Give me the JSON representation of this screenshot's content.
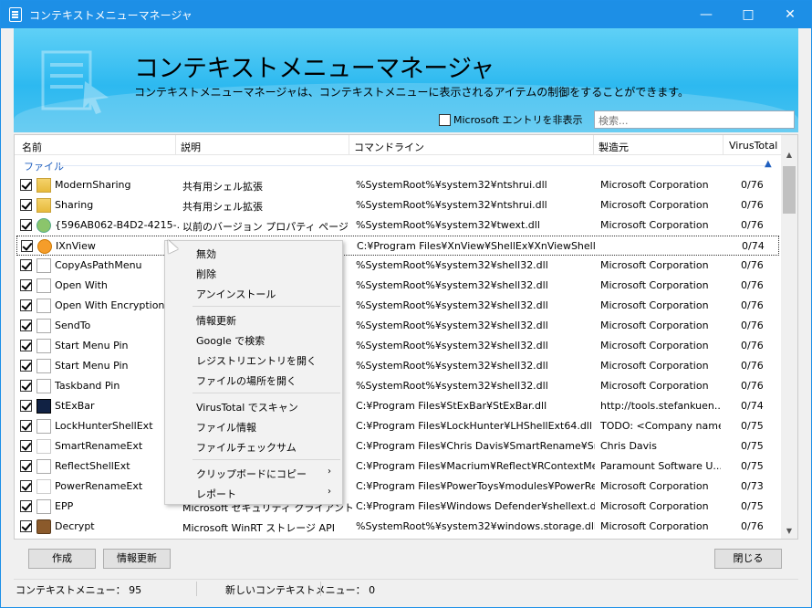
{
  "window": {
    "title": "コンテキストメニューマネージャ",
    "minimize": "—",
    "maximize": "□",
    "close": "✕"
  },
  "header": {
    "title": "コンテキストメニューマネージャ",
    "subtitle": "コンテキストメニューマネージャは、コンテキストメニューに表示されるアイテムの制御をすることができます。",
    "hide_ms_label": "Microsoft エントリを非表示",
    "search_placeholder": "検索..."
  },
  "columns": [
    "名前",
    "説明",
    "コマンドライン",
    "製造元",
    "VirusTotal"
  ],
  "group": {
    "label": "ファイル",
    "arrow": "▲"
  },
  "rows": [
    {
      "name": "ModernSharing",
      "desc": "共有用シェル拡張",
      "cmd": "%SystemRoot%¥system32¥ntshrui.dll",
      "maker": "Microsoft Corporation",
      "vt": "0/76",
      "icon": "folder-share-icon",
      "checked": true
    },
    {
      "name": "Sharing",
      "desc": "共有用シェル拡張",
      "cmd": "%SystemRoot%¥system32¥ntshrui.dll",
      "maker": "Microsoft Corporation",
      "vt": "0/76",
      "icon": "folder-share-icon",
      "checked": true
    },
    {
      "name": "{596AB062-B4D2-4215-...",
      "desc": "以前のバージョン プロパティ ページ",
      "cmd": "%SystemRoot%¥system32¥twext.dll",
      "maker": "Microsoft Corporation",
      "vt": "0/76",
      "icon": "clock-icon",
      "checked": true
    },
    {
      "name": "IXnView",
      "desc": "",
      "cmd": "C:¥Program Files¥XnView¥ShellEx¥XnViewShellExt...",
      "maker": "",
      "vt": "0/74",
      "icon": "xnview-icon",
      "checked": true
    },
    {
      "name": "CopyAsPathMenu",
      "desc": "",
      "cmd": "%SystemRoot%¥system32¥shell32.dll",
      "maker": "Microsoft Corporation",
      "vt": "0/76",
      "icon": "document-icon",
      "checked": true
    },
    {
      "name": "Open With",
      "desc": "",
      "cmd": "%SystemRoot%¥system32¥shell32.dll",
      "maker": "Microsoft Corporation",
      "vt": "0/76",
      "icon": "document-icon",
      "checked": true
    },
    {
      "name": "Open With EncryptionM...",
      "desc": "",
      "cmd": "%SystemRoot%¥system32¥shell32.dll",
      "maker": "Microsoft Corporation",
      "vt": "0/76",
      "icon": "document-icon",
      "checked": true
    },
    {
      "name": "SendTo",
      "desc": "",
      "cmd": "%SystemRoot%¥system32¥shell32.dll",
      "maker": "Microsoft Corporation",
      "vt": "0/76",
      "icon": "document-icon",
      "checked": true
    },
    {
      "name": "Start Menu Pin",
      "desc": "",
      "cmd": "%SystemRoot%¥system32¥shell32.dll",
      "maker": "Microsoft Corporation",
      "vt": "0/76",
      "icon": "document-icon",
      "checked": true
    },
    {
      "name": "Start Menu Pin",
      "desc": "",
      "cmd": "%SystemRoot%¥system32¥shell32.dll",
      "maker": "Microsoft Corporation",
      "vt": "0/76",
      "icon": "document-icon",
      "checked": true
    },
    {
      "name": "Taskband Pin",
      "desc": "",
      "cmd": "%SystemRoot%¥system32¥shell32.dll",
      "maker": "Microsoft Corporation",
      "vt": "0/76",
      "icon": "document-icon",
      "checked": true
    },
    {
      "name": "StExBar",
      "desc": "",
      "cmd": "C:¥Program Files¥StExBar¥StExBar.dll",
      "maker": "http://tools.stefankuen...",
      "vt": "0/74",
      "icon": "terminal-icon",
      "checked": true
    },
    {
      "name": "LockHunterShellExt",
      "desc": "",
      "cmd": "C:¥Program Files¥LockHunter¥LHShellExt64.dll",
      "maker": "TODO: <Company name>",
      "vt": "0/75",
      "icon": "document-icon",
      "checked": true
    },
    {
      "name": "SmartRenameExt",
      "desc": "",
      "cmd": "C:¥Program Files¥Chris Davis¥SmartRename¥Sma...",
      "maker": "Chris Davis",
      "vt": "0/75",
      "icon": "rename-icon",
      "checked": true
    },
    {
      "name": "ReflectShellExt",
      "desc": "",
      "cmd": "C:¥Program Files¥Macrium¥Reflect¥RContextMen...",
      "maker": "Paramount Software U...",
      "vt": "0/75",
      "icon": "document-icon",
      "checked": true
    },
    {
      "name": "PowerRenameExt",
      "desc": "",
      "cmd": "C:¥Program Files¥PowerToys¥modules¥PowerRen...",
      "maker": "Microsoft Corporation",
      "vt": "0/73",
      "icon": "powerrename-icon",
      "checked": true
    },
    {
      "name": "EPP",
      "desc": "Microsoft セキュリティ クライアント ...",
      "cmd": "C:¥Program Files¥Windows Defender¥shellext.dll",
      "maker": "Microsoft Corporation",
      "vt": "0/75",
      "icon": "document-icon",
      "checked": true
    },
    {
      "name": "Decrypt",
      "desc": "Microsoft WinRT ストレージ API",
      "cmd": "%SystemRoot%¥system32¥windows.storage.dll",
      "maker": "Microsoft Corporation",
      "vt": "0/76",
      "icon": "briefcase-icon",
      "checked": true
    }
  ],
  "context_menu": {
    "items": [
      "無効",
      "削除",
      "アンインストール",
      "情報更新",
      "Google で検索",
      "レジストリエントリを開く",
      "ファイルの場所を開く",
      "VirusTotal でスキャン",
      "ファイル情報",
      "ファイルチェックサム",
      "クリップボードにコピー",
      "レポート"
    ],
    "arrow": "›"
  },
  "buttons": {
    "create": "作成",
    "refresh": "情報更新",
    "close": "閉じる"
  },
  "status": {
    "menus": "コンテキストメニュー： 95",
    "new_menus": "新しいコンテキストメニュー： 0"
  },
  "colors": {
    "titlebar": "#1d8fe6",
    "header": "#2db9f0",
    "group": "#1f5fbf"
  }
}
